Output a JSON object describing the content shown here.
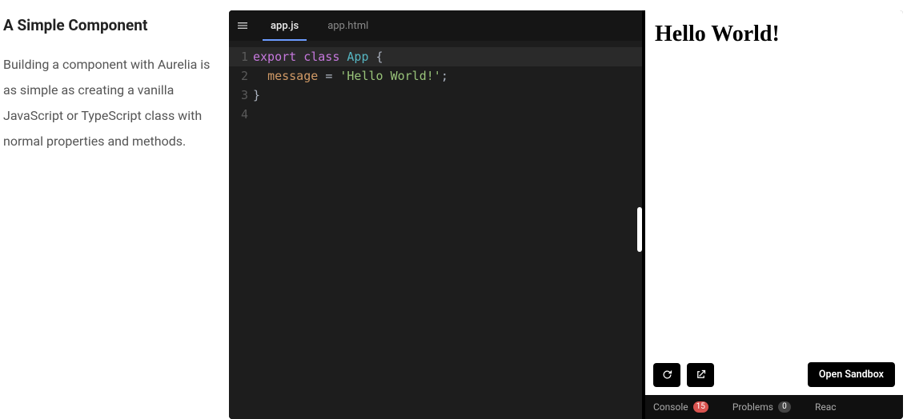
{
  "doc": {
    "title": "A Simple Component",
    "body": "Building a component with Aurelia is as simple as creating a vanilla JavaScript or TypeScript class with normal properties and methods."
  },
  "editor": {
    "tabs": [
      {
        "label": "app.js",
        "active": true
      },
      {
        "label": "app.html",
        "active": false
      }
    ],
    "lines": [
      {
        "n": 1,
        "tokens": [
          {
            "t": "export",
            "c": "keyword"
          },
          {
            "t": " "
          },
          {
            "t": "class",
            "c": "keyword"
          },
          {
            "t": " "
          },
          {
            "t": "App",
            "c": "class"
          },
          {
            "t": " "
          },
          {
            "t": "{",
            "c": "punct"
          }
        ]
      },
      {
        "n": 2,
        "tokens": [
          {
            "t": "  "
          },
          {
            "t": "message",
            "c": "ident"
          },
          {
            "t": " "
          },
          {
            "t": "=",
            "c": "punct"
          },
          {
            "t": " "
          },
          {
            "t": "'Hello World!'",
            "c": "string"
          },
          {
            "t": ";",
            "c": "punct"
          }
        ]
      },
      {
        "n": 3,
        "tokens": [
          {
            "t": "}",
            "c": "punct"
          }
        ]
      },
      {
        "n": 4,
        "tokens": [
          {
            "t": ""
          }
        ]
      }
    ]
  },
  "preview": {
    "output_heading": "Hello World!",
    "open_sandbox_label": "Open Sandbox"
  },
  "bottom": {
    "console": {
      "label": "Console",
      "badge": "15",
      "badgeColor": "red"
    },
    "problems": {
      "label": "Problems",
      "badge": "0",
      "badgeColor": "grey"
    },
    "react": {
      "label": "Reac"
    }
  }
}
